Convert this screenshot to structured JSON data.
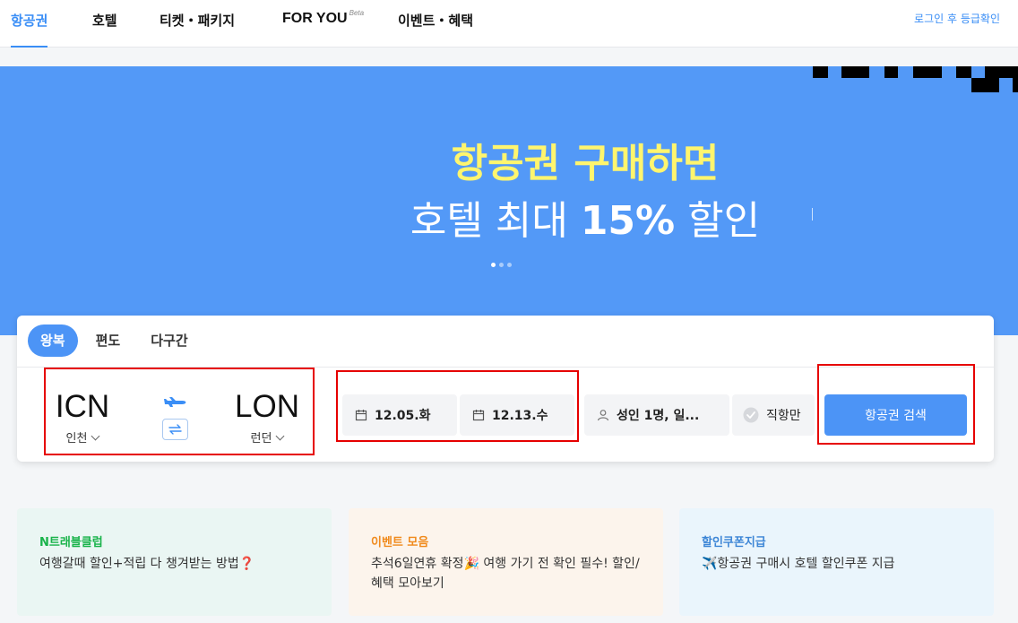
{
  "nav": {
    "items": [
      {
        "label": "항공권",
        "active": true
      },
      {
        "label": "호텔",
        "active": false
      },
      {
        "label": "티켓・패키지",
        "active": false
      },
      {
        "label": "FOR YOU",
        "badge": "Beta",
        "active": false
      },
      {
        "label": "이벤트・혜택",
        "active": false
      }
    ],
    "login_label": "로그인 후 등급확인"
  },
  "hero": {
    "title_line1": "항공권 구매하면",
    "title_line2_prefix": "호텔 최대 ",
    "title_line2_strong": "15%",
    "title_line2_suffix": " 할인",
    "slide_count": 3,
    "active_slide": 1,
    "colors": {
      "background": "#5399f7",
      "highlight": "#fff56e"
    }
  },
  "search": {
    "tabs": [
      {
        "label": "왕복",
        "active": true
      },
      {
        "label": "편도",
        "active": false
      },
      {
        "label": "다구간",
        "active": false
      }
    ],
    "origin": {
      "code": "ICN",
      "city": "인천"
    },
    "destination": {
      "code": "LON",
      "city": "런던"
    },
    "depart_date": "12.05.화",
    "return_date": "12.13.수",
    "passengers": "성인 1명, 일...",
    "direct_label": "직항만",
    "submit_label": "항공권 검색",
    "icons": {
      "plane": "airplane-icon",
      "swap": "swap-icon",
      "calendar": "calendar-icon",
      "person": "person-icon",
      "check": "check-circle-icon"
    },
    "accent_color": "#4c94f6"
  },
  "promos": [
    {
      "title": "N트래블클럽",
      "body": "여행갈때 할인+적립 다 챙겨받는 방법❓",
      "title_color": "#19b34a",
      "bg": "#eaf6f3"
    },
    {
      "title": "이벤트 모음",
      "body": "추석6일연휴 확정🎉 여행 가기 전 확인 필수! 할인/혜택 모아보기",
      "title_color": "#f08a1c",
      "bg": "#fcf4ec"
    },
    {
      "title": "할인쿠폰지급",
      "body": "✈️항공권 구매시 호텔 할인쿠폰 지급",
      "title_color": "#3d86d6",
      "bg": "#eaf5fc"
    }
  ]
}
